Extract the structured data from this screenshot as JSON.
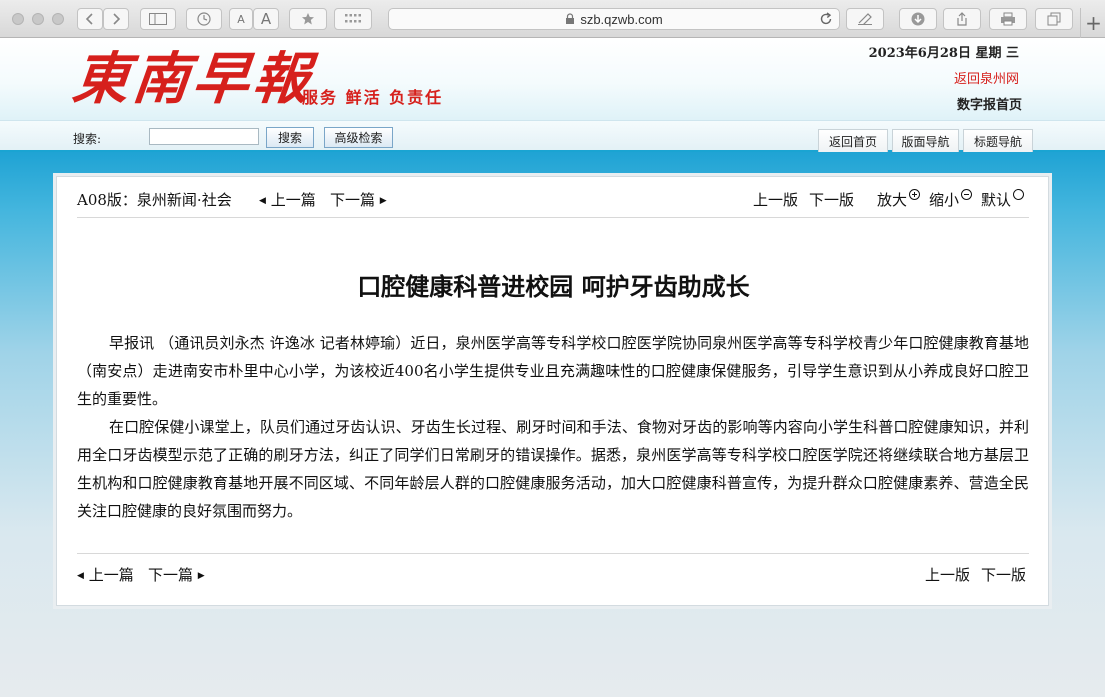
{
  "browser": {
    "url": "szb.qzwb.com",
    "font_small": "A",
    "font_large": "A"
  },
  "masthead": {
    "logo": "東南早報",
    "slogan": "服务 鲜活 负责任",
    "date": "2023年6月28日 星期 三",
    "link_return": "返回泉州网",
    "link_home": "数字报首页"
  },
  "search": {
    "label": "搜索:",
    "input_value": "",
    "search_button": "搜索",
    "advanced_button": "高级检索",
    "tabs": [
      "返回首页",
      "版面导航",
      "标题导航"
    ]
  },
  "article_nav": {
    "section": "A08版：泉州新闻·社会",
    "prev_article": "上一篇",
    "next_article": "下一篇",
    "prev_page": "上一版",
    "next_page": "下一版",
    "zoom_in": "放大",
    "zoom_out": "缩小",
    "default": "默认"
  },
  "article": {
    "title": "口腔健康科普进校园 呵护牙齿助成长",
    "paragraphs": [
      "早报讯 （通讯员刘永杰 许逸冰 记者林婷瑜）近日，泉州医学高等专科学校口腔医学院协同泉州医学高等专科学校青少年口腔健康教育基地（南安点）走进南安市朴里中心小学，为该校近400名小学生提供专业且充满趣味性的口腔健康保健服务，引导学生意识到从小养成良好口腔卫生的重要性。",
      "在口腔保健小课堂上，队员们通过牙齿认识、牙齿生长过程、刷牙时间和手法、食物对牙齿的影响等内容向小学生科普口腔健康知识，并利用全口牙齿模型示范了正确的刷牙方法，纠正了同学们日常刷牙的错误操作。据悉，泉州医学高等专科学校口腔医学院还将继续联合地方基层卫生机构和口腔健康教育基地开展不同区域、不同年龄层人群的口腔健康服务活动，加大口腔健康科普宣传，为提升群众口腔健康素养、营造全民关注口腔健康的良好氛围而努力。"
    ]
  }
}
